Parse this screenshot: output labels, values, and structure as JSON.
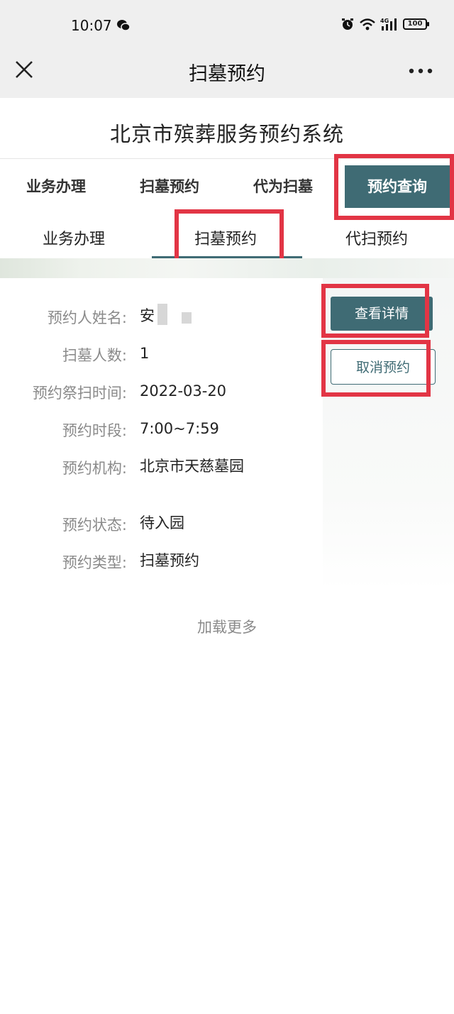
{
  "status_bar": {
    "time": "10:07",
    "network": "4G",
    "battery": "100",
    "icons": [
      "wechat-icon",
      "alarm-icon",
      "wifi-icon",
      "signal-icon",
      "battery-icon"
    ]
  },
  "nav": {
    "title": "扫墓预约",
    "close_icon": "close-icon",
    "more_icon": "more-icon"
  },
  "system_title": "北京市殡葬服务预约系统",
  "main_tabs": [
    {
      "label": "业务办理"
    },
    {
      "label": "扫墓预约"
    },
    {
      "label": "代为扫墓"
    },
    {
      "label": "预约查询",
      "active": true
    }
  ],
  "sub_tabs": [
    {
      "label": "业务办理"
    },
    {
      "label": "扫墓预约",
      "active": true
    },
    {
      "label": "代扫预约"
    }
  ],
  "record": {
    "rows": [
      {
        "label": "预约人姓名:",
        "value": "安"
      },
      {
        "label": "扫墓人数:",
        "value": "1"
      },
      {
        "label": "预约祭扫时间:",
        "value": "2022-03-20"
      },
      {
        "label": "预约时段:",
        "value": "7:00~7:59"
      },
      {
        "label": "预约机构:",
        "value": "北京市天慈墓园"
      },
      {
        "label": "预约状态:",
        "value": "待入园"
      },
      {
        "label": "预约类型:",
        "value": "扫墓预约"
      }
    ],
    "detail_button": "查看详情",
    "cancel_button": "取消预约"
  },
  "load_more": "加载更多",
  "colors": {
    "accent": "#3f6b74",
    "highlight": "#e23545",
    "label_gray": "#8a8a8a",
    "bar_bg": "#efefef"
  }
}
